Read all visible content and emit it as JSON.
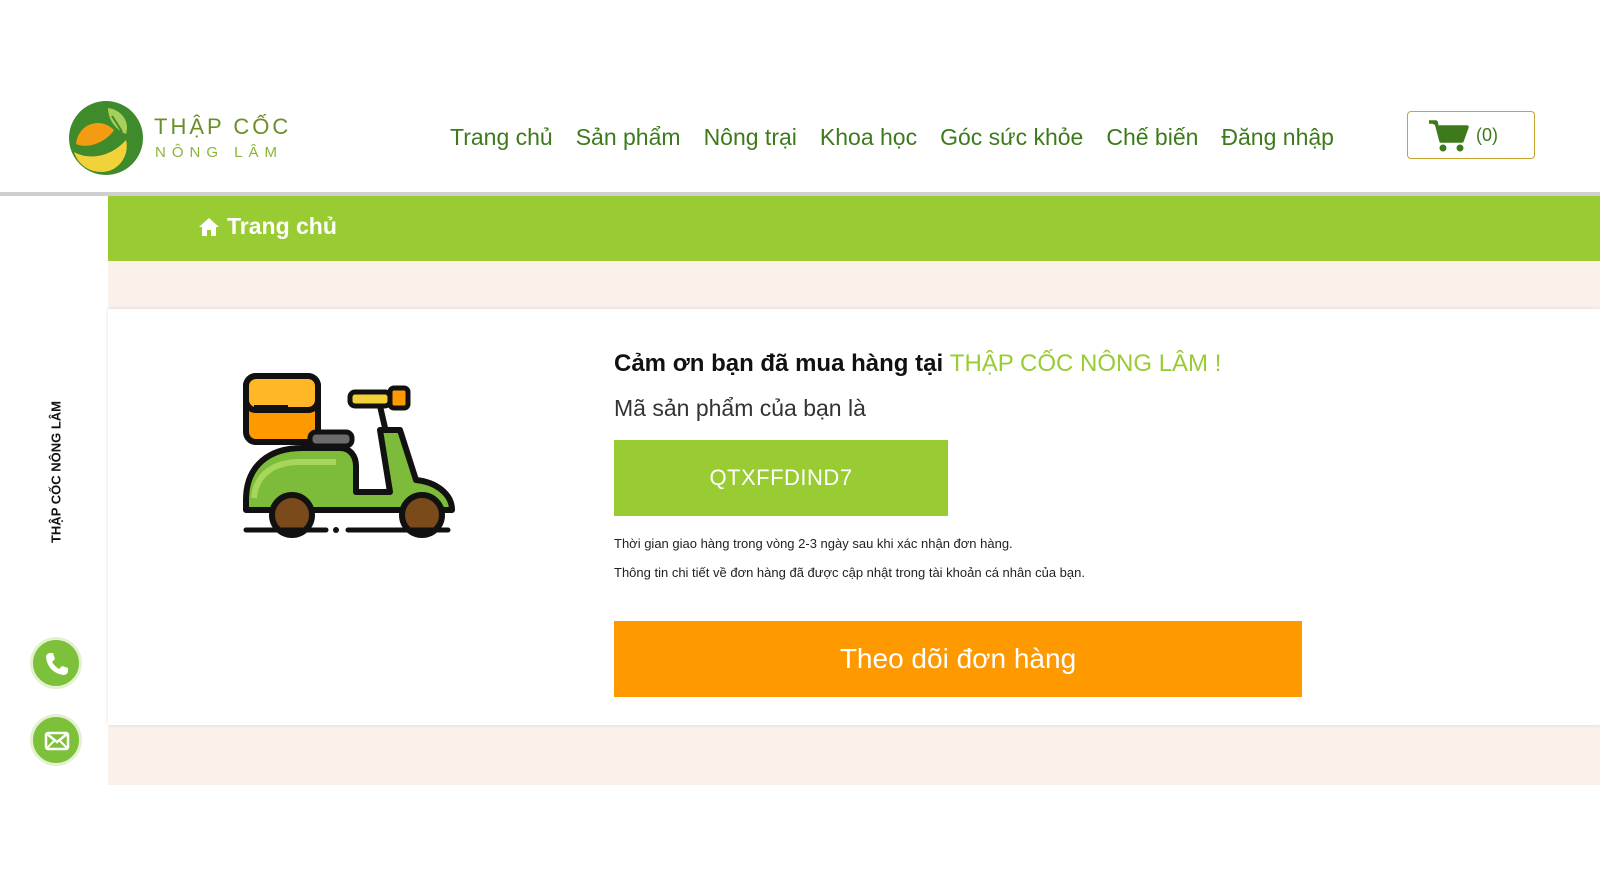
{
  "header": {
    "logo": {
      "line1": "THẬP CỐC",
      "line2": "NÔNG LÂM"
    },
    "nav": [
      {
        "label": "Trang chủ"
      },
      {
        "label": "Sản phẩm"
      },
      {
        "label": "Nông trại"
      },
      {
        "label": "Khoa học"
      },
      {
        "label": "Góc sức khỏe"
      },
      {
        "label": "Chế biến"
      },
      {
        "label": "Đăng nhập"
      }
    ],
    "cart": {
      "count": "(0)",
      "icon": "cart-icon"
    }
  },
  "breadcrumb": {
    "icon": "home-icon",
    "label": "Trang chủ"
  },
  "order": {
    "thanks_prefix": "Cảm ơn bạn đã mua hàng tại ",
    "thanks_brand": "THẬP CỐC NÔNG LÂM !",
    "code_label": "Mã sản phẩm của bạn là",
    "code": "QTXFFDIND7",
    "note1": "Thời gian giao hàng trong vòng 2-3 ngày sau khi xác nhận đơn hàng.",
    "note2": "Thông tin chi tiết về đơn hàng đã được cập nhật trong tài khoản cá nhân của bạn.",
    "track_button": "Theo dõi đơn hàng",
    "illustration": "delivery-scooter-icon"
  },
  "sidebar": {
    "brand": "THẬP CỐC NÔNG LÂM",
    "buttons": [
      {
        "icon": "phone-icon"
      },
      {
        "icon": "mail-icon"
      }
    ]
  },
  "colors": {
    "accent_green": "#99cc33",
    "nav_green": "#3d7a1b",
    "accent_orange": "#ff9900",
    "page_bg": "#fbf1eb"
  }
}
